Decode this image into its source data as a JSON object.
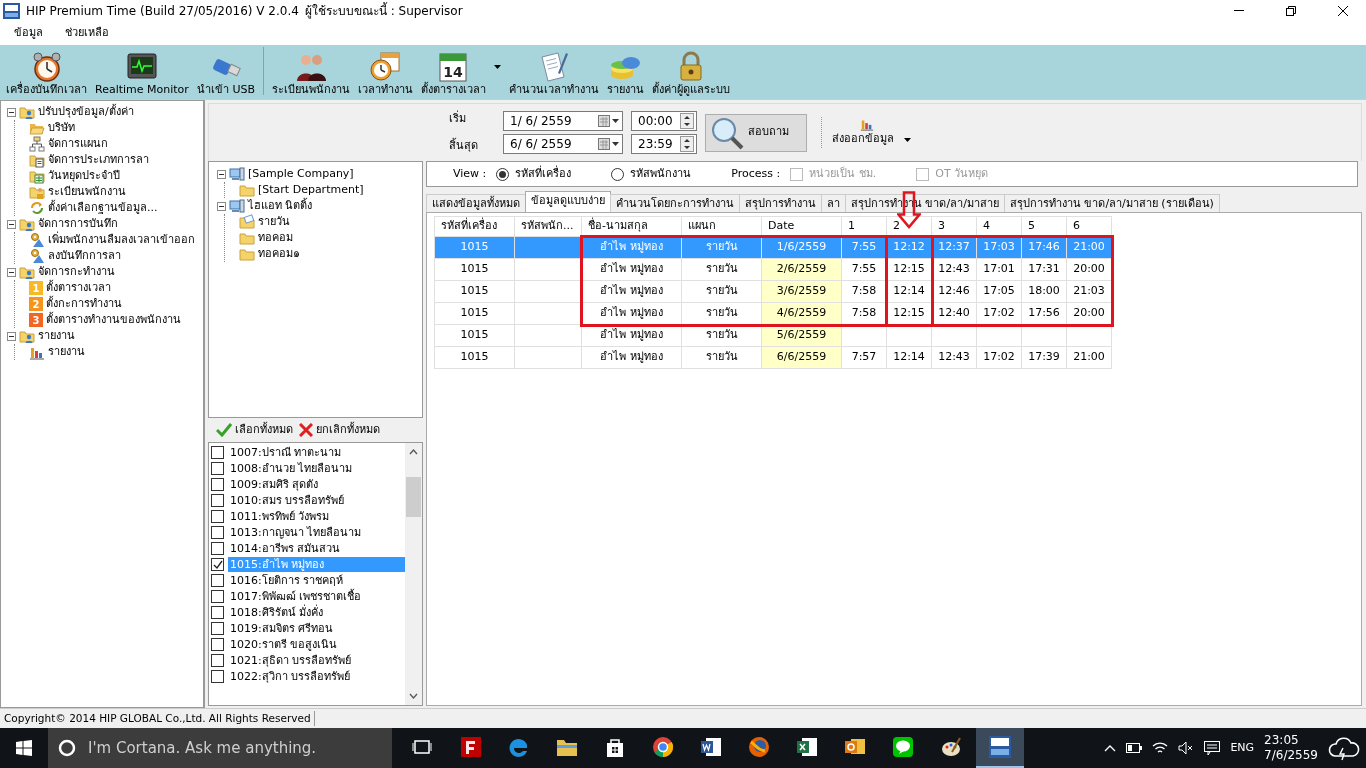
{
  "window": {
    "title": "HIP Premium Time (Build 27/05/2016) V 2.0.4",
    "user_label": "ผู้ใช้ระบบขณะนี้ : Supervisor"
  },
  "menu": [
    "ข้อมูล",
    "ช่วยเหลือ"
  ],
  "toolbar_groups": [
    {
      "items": [
        {
          "label": "เครื่องบันทึกเวลา",
          "kind": "alarm-clock",
          "dropdown": false
        },
        {
          "label": "Realtime Monitor",
          "kind": "monitor",
          "dropdown": false
        },
        {
          "label": "นำเข้า USB",
          "kind": "usb",
          "dropdown": false
        }
      ]
    },
    {
      "items": [
        {
          "label": "ระเบียนพนักงาน",
          "kind": "people",
          "dropdown": false
        },
        {
          "label": "เวลาทำงาน",
          "kind": "clock-calendar",
          "dropdown": false
        },
        {
          "label": "ตั้งตารางเวลา",
          "kind": "calendar",
          "calendar_day": "14",
          "dropdown": true
        },
        {
          "label": "คำนวนเวลาทำงาน",
          "kind": "document",
          "dropdown": false
        },
        {
          "label": "รายงาน",
          "kind": "database",
          "dropdown": false
        },
        {
          "label": "ตั้งค่าผู้ดูแลระบบ",
          "kind": "lock",
          "dropdown": false
        }
      ]
    }
  ],
  "nav_tree": [
    {
      "label": "ปรับปรุงข้อมูล/ตั้งค่า",
      "kind": "folder-users",
      "expanded": true,
      "children": [
        {
          "label": "บริษัท",
          "kind": "folder-open"
        },
        {
          "label": "จัดการแผนก",
          "kind": "org"
        },
        {
          "label": "จัดการประเภทการลา",
          "kind": "folder-doc"
        },
        {
          "label": "วันหยุดประจำปี",
          "kind": "folder-sheet"
        },
        {
          "label": "ระเบียนพนักงาน",
          "kind": "folder-person"
        },
        {
          "label": "ตั้งค่าเลือกฐานข้อมูล...",
          "kind": "sync"
        }
      ]
    },
    {
      "label": "จัดการการบันทึก",
      "kind": "folder-users",
      "expanded": true,
      "children": [
        {
          "label": "เพิ่มพนักงานลืมลงเวลาเข้าออก",
          "kind": "gear"
        },
        {
          "label": "ลงบันทึกการลา",
          "kind": "gear"
        }
      ]
    },
    {
      "label": "จัดการกะทำงาน",
      "kind": "folder-users",
      "expanded": true,
      "children": [
        {
          "label": "ตั้งตารางเวลา",
          "kind": "number",
          "badge": "1",
          "color": "#f9b924"
        },
        {
          "label": "ตั้งกะการทำงาน",
          "kind": "number",
          "badge": "2",
          "color": "#f7941d"
        },
        {
          "label": "ตั้งตารางทำงานของพนักงาน",
          "kind": "number",
          "badge": "3",
          "color": "#f26522"
        }
      ]
    },
    {
      "label": "รายงาน",
      "kind": "folder-users",
      "expanded": true,
      "children": [
        {
          "label": "รายงาน",
          "kind": "bars"
        }
      ]
    }
  ],
  "filter": {
    "start": {
      "label": "เริ่ม",
      "date": "1/ 6/ 2559",
      "time": "00:00"
    },
    "end": {
      "label": "สิ้นสุด",
      "date": "6/ 6/ 2559",
      "time": "23:59"
    },
    "query_button": "สอบถาม",
    "export_button": "ส่งออกข้อมูล"
  },
  "company_tree": [
    {
      "label": "[Sample Company]",
      "kind": "computer",
      "expanded": true,
      "children": [
        {
          "label": "[Start Department]",
          "kind": "folder"
        }
      ]
    },
    {
      "label": "ไฮแอท นิตติ้ง",
      "kind": "computer",
      "expanded": true,
      "children": [
        {
          "label": "รายวัน",
          "kind": "folder-letter"
        },
        {
          "label": "ทอคอม",
          "kind": "folder"
        },
        {
          "label": "ทอคอม๑",
          "kind": "folder"
        }
      ]
    }
  ],
  "select_buttons": {
    "select_all": "เลือกทั้งหมด",
    "clear_all": "ยกเลิกทั้งหมด"
  },
  "employees": [
    {
      "label": "1007:ปราณี  ทาตะนาม",
      "checked": false,
      "selected": false
    },
    {
      "label": "1008:อำนวย  ไทยลือนาม",
      "checked": false,
      "selected": false
    },
    {
      "label": "1009:สมศิริ  สุดตัง",
      "checked": false,
      "selected": false
    },
    {
      "label": "1010:สมร  บรรลือทรัพย์",
      "checked": false,
      "selected": false
    },
    {
      "label": "1011:พรทิพย์  วังพรม",
      "checked": false,
      "selected": false
    },
    {
      "label": "1013:กาญจนา ไทยลือนาม",
      "checked": false,
      "selected": false
    },
    {
      "label": "1014:อารีพร  สมันสวน",
      "checked": false,
      "selected": false
    },
    {
      "label": "1015:อำไพ  หมู่ทอง",
      "checked": true,
      "selected": true
    },
    {
      "label": "1016:โยติการ ราชคฤห์",
      "checked": false,
      "selected": false
    },
    {
      "label": "1017:พิพัฒฒ์ เพชรชาตเชื้อ",
      "checked": false,
      "selected": false
    },
    {
      "label": "1018:ศิริรัตน์  มั่งคั่ง",
      "checked": false,
      "selected": false
    },
    {
      "label": "1019:สมจิตร ศรีทอน",
      "checked": false,
      "selected": false
    },
    {
      "label": "1020:ราตรี ขอสูงเนิน",
      "checked": false,
      "selected": false
    },
    {
      "label": "1021:สุธิดา  บรรลือทรัพย์",
      "checked": false,
      "selected": false
    },
    {
      "label": "1022:สุวิกา บรรลือทรัพย์",
      "checked": false,
      "selected": false
    }
  ],
  "view_bar": {
    "view_label": "View :",
    "view_options": [
      {
        "label": "รหัสที่เครื่อง",
        "selected": true
      },
      {
        "label": "รหัสพนักงาน",
        "selected": false
      }
    ],
    "process_label": "Process :",
    "process_options": [
      {
        "label": "หน่วยเป็น ชม.",
        "checked": false,
        "disabled": true
      },
      {
        "label": "OT วันหยุด",
        "checked": false,
        "disabled": true
      }
    ]
  },
  "tabs": [
    {
      "label": "แสดงข้อมูลทั้งหมด",
      "selected": false
    },
    {
      "label": "ข้อมูลดูแบบง่าย",
      "selected": true
    },
    {
      "label": "คำนวนโดยกะการทำงาน",
      "selected": false
    },
    {
      "label": "สรุปการทำงาน",
      "selected": false
    },
    {
      "label": "ลา",
      "selected": false
    },
    {
      "label": "สรุปการทำงาน ขาด/ลา/มาสาย",
      "selected": false
    },
    {
      "label": "สรุปการทำงาน ขาด/ลา/มาสาย (รายเดือน)",
      "selected": false
    }
  ],
  "table": {
    "columns": [
      {
        "label": "รหัสที่เครื่อง",
        "highlight": false
      },
      {
        "label": "รหัสพนัก...",
        "highlight": false
      },
      {
        "label": "ชื่อ-นามสกุล",
        "highlight": false
      },
      {
        "label": "แผนก",
        "highlight": false
      },
      {
        "label": "Date",
        "highlight": true
      },
      {
        "label": "1",
        "highlight": false
      },
      {
        "label": "2",
        "highlight": false
      },
      {
        "label": "3",
        "highlight": false
      },
      {
        "label": "4",
        "highlight": false
      },
      {
        "label": "5",
        "highlight": false
      },
      {
        "label": "6",
        "highlight": false
      }
    ],
    "rows": [
      {
        "selected": true,
        "cells": [
          "1015",
          null,
          "อำไพ  หมู่ทอง",
          "รายวัน",
          "1/6/2559",
          "7:55",
          "12:12",
          "12:37",
          "17:03",
          "17:46",
          "21:00"
        ]
      },
      {
        "selected": false,
        "cells": [
          "1015",
          null,
          "อำไพ  หมู่ทอง",
          "รายวัน",
          "2/6/2559",
          "7:55",
          "12:15",
          "12:43",
          "17:01",
          "17:31",
          "20:00"
        ]
      },
      {
        "selected": false,
        "cells": [
          "1015",
          null,
          "อำไพ  หมู่ทอง",
          "รายวัน",
          "3/6/2559",
          "7:58",
          "12:14",
          "12:46",
          "17:05",
          "18:00",
          "21:03"
        ]
      },
      {
        "selected": false,
        "cells": [
          "1015",
          null,
          "อำไพ  หมู่ทอง",
          "รายวัน",
          "4/6/2559",
          "7:58",
          "12:15",
          "12:40",
          "17:02",
          "17:56",
          "20:00"
        ]
      },
      {
        "selected": false,
        "cells": [
          "1015",
          null,
          "อำไพ  หมู่ทอง",
          "รายวัน",
          "5/6/2559",
          null,
          null,
          null,
          null,
          null,
          null
        ]
      },
      {
        "selected": false,
        "cells": [
          "1015",
          null,
          "อำไพ  หมู่ทอง",
          "รายวัน",
          "6/6/2559",
          "7:57",
          "12:14",
          "12:43",
          "17:02",
          "17:39",
          "21:00"
        ]
      }
    ]
  },
  "status_bar": "Copyright© 2014 HIP GLOBAL Co.,Ltd. All Rights Reserved",
  "taskbar": {
    "search_placeholder": "I'm Cortana. Ask me anything.",
    "apps": [
      {
        "kind": "task-view",
        "active": false
      },
      {
        "kind": "red-tile",
        "active": false
      },
      {
        "kind": "browser",
        "active": false
      },
      {
        "kind": "folder",
        "active": false
      },
      {
        "kind": "store",
        "active": false
      },
      {
        "kind": "chrome",
        "active": false
      },
      {
        "kind": "word",
        "active": false
      },
      {
        "kind": "firefox",
        "active": false
      },
      {
        "kind": "excel",
        "active": false
      },
      {
        "kind": "mail",
        "active": false
      },
      {
        "kind": "chat",
        "active": false
      },
      {
        "kind": "paint",
        "active": false
      },
      {
        "kind": "hip",
        "active": true
      }
    ],
    "language": "ENG",
    "time": "23:05",
    "date": "7/6/2559"
  }
}
